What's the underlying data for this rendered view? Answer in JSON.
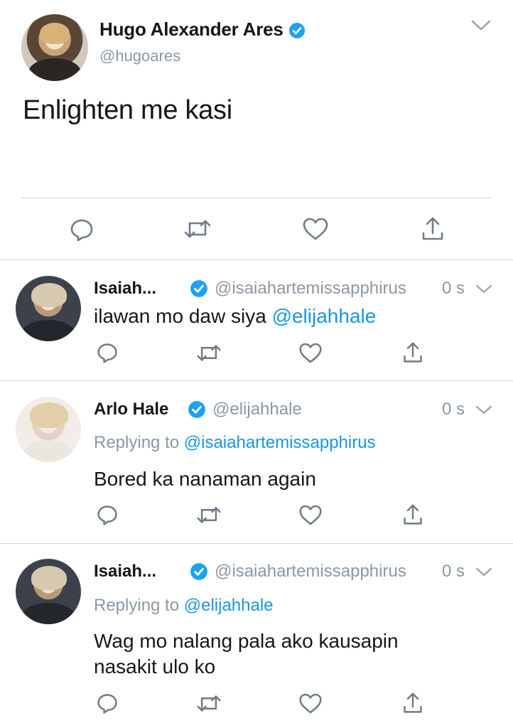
{
  "main_tweet": {
    "name": "Hugo Alexander Ares",
    "handle": "@hugoares",
    "text": "Enlighten me kasi"
  },
  "replies": [
    {
      "name": "Isaiah...",
      "handle": "@isaiahartemissapphirus",
      "time": "0 s",
      "replying_label": "",
      "replying_to": "",
      "text_plain": "ilawan mo daw siya ",
      "text_mention": "@elijahhale"
    },
    {
      "name": "Arlo Hale",
      "handle": "@elijahhale",
      "time": "0 s",
      "replying_label": "Replying to ",
      "replying_to": "@isaiahartemissapphirus",
      "text": "Bored ka nanaman again"
    },
    {
      "name": "Isaiah...",
      "handle": "@isaiahartemissapphirus",
      "time": "0 s",
      "replying_label": "Replying to ",
      "replying_to": "@elijahhale",
      "text_line1": "Wag mo nalang pala ako kausapin",
      "text_line2": "nasakit ulo ko"
    }
  ],
  "icons": [
    "reply-icon",
    "retweet-icon",
    "like-icon",
    "share-icon",
    "verified-icon",
    "chevron-down-icon"
  ],
  "colors": {
    "accent": "#1b95e0",
    "muted": "#8b98a5",
    "text": "#14171a",
    "icon": "#6e7b87"
  }
}
